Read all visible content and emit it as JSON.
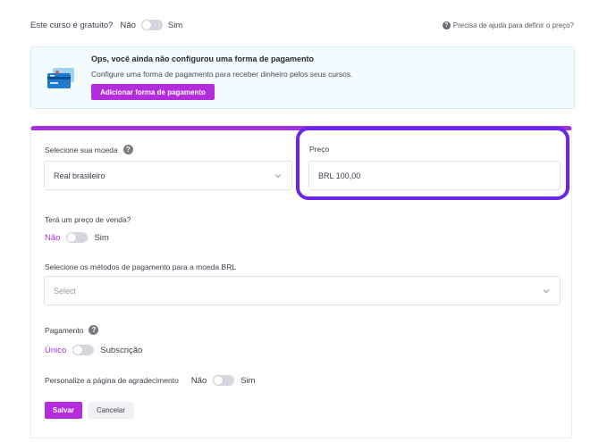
{
  "free_course": {
    "label": "Este curso é gratuito?",
    "option_no": "Não",
    "option_yes": "Sim",
    "help_text": "Precisa de ajuda para definir o preço?"
  },
  "alert": {
    "title": "Ops, você ainda não configurou uma forma de pagamento",
    "text": "Configure uma forma de pagamento para receber dinheiro pelos seus cursos.",
    "button": "Adicionar forma de pagamento"
  },
  "currency": {
    "label": "Selecione sua moeda",
    "value": "Real brasileiro"
  },
  "price": {
    "label": "Preço",
    "value": "BRL 100,00"
  },
  "sale_price": {
    "label": "Terá um preço de venda?",
    "option_no": "Não",
    "option_yes": "Sim"
  },
  "payment_methods": {
    "label": "Selecione os métodos de pagamento para a moeda BRL",
    "placeholder": "Select"
  },
  "payment": {
    "label": "Pagamento",
    "option_once": "Único",
    "option_subscription": "Subscrição"
  },
  "thank_you": {
    "label": "Personalize a página de agradecimento",
    "option_no": "Não",
    "option_yes": "Sim"
  },
  "actions": {
    "save": "Salvar",
    "cancel": "Cancelar"
  },
  "colors": {
    "accent": "#b32ddc",
    "panel_border": "#a533dd",
    "highlight": "#6a26e8"
  }
}
